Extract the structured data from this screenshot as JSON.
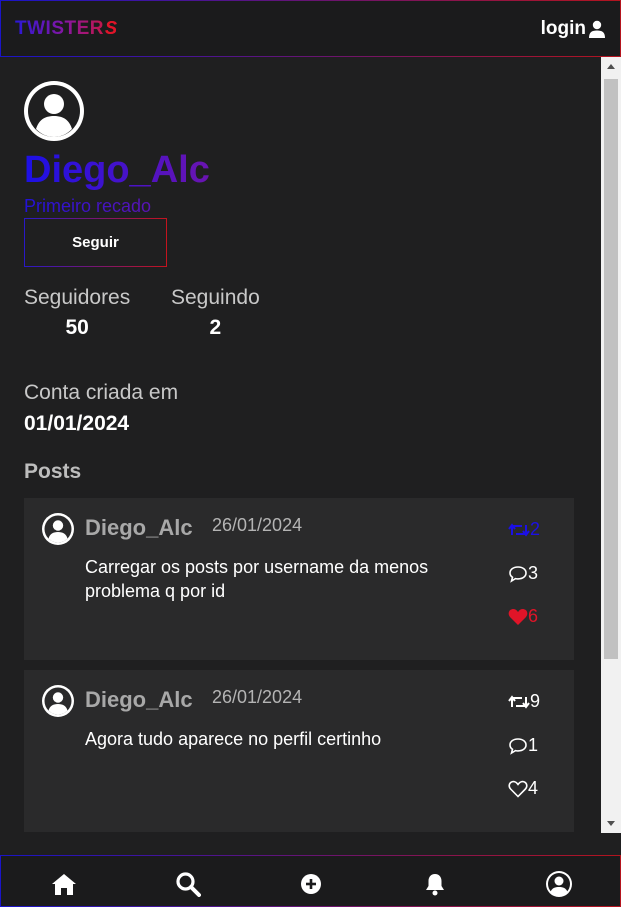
{
  "header": {
    "logo_text": "TWISTER",
    "logo_mark": "S",
    "login_label": "login"
  },
  "profile": {
    "username": "Diego_Alc",
    "bio": "Primeiro recado",
    "follow_label": "Seguir",
    "followers_label": "Seguidores",
    "followers_count": "50",
    "following_label": "Seguindo",
    "following_count": "2",
    "created_label": "Conta criada em",
    "created_date": "01/01/2024"
  },
  "posts_heading": "Posts",
  "posts": [
    {
      "author": "Diego_Alc",
      "date": "26/01/2024",
      "text": "Carregar os posts por username da menos problema q por id",
      "retweets": "2",
      "comments": "3",
      "likes": "6",
      "retweeted": true,
      "liked": true
    },
    {
      "author": "Diego_Alc",
      "date": "26/01/2024",
      "text": "Agora tudo aparece no perfil certinho",
      "retweets": "9",
      "comments": "1",
      "likes": "4",
      "retweeted": false,
      "liked": false
    }
  ],
  "colors": {
    "accent_blue": "#1c10e6",
    "accent_red": "#e01428",
    "background": "#1f1f20",
    "card": "#2a2a2b"
  },
  "bottom_nav": [
    "home-icon",
    "search-icon",
    "plus-circle-icon",
    "bell-icon",
    "user-circle-icon"
  ]
}
